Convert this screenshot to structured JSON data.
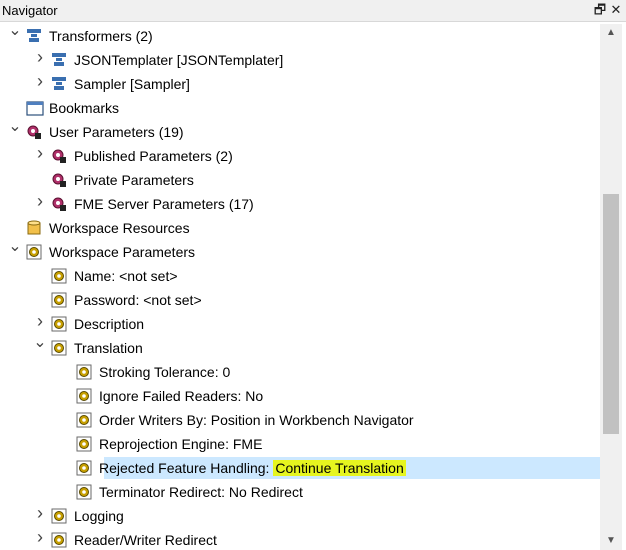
{
  "window": {
    "title": "Navigator",
    "restore_glyph": "🗗",
    "close_glyph": "✕"
  },
  "tree": [
    {
      "id": "transformers",
      "label": "Transformers (2)",
      "icon": "transformer-icon",
      "state": "expanded",
      "level": 0
    },
    {
      "id": "jsontemplater",
      "label": "JSONTemplater [JSONTemplater]",
      "icon": "transformer-icon",
      "state": "collapsed",
      "level": 1
    },
    {
      "id": "sampler",
      "label": "Sampler [Sampler]",
      "icon": "transformer-icon",
      "state": "collapsed",
      "level": 1
    },
    {
      "id": "bookmarks",
      "label": "Bookmarks",
      "icon": "bookmark-icon",
      "state": "none",
      "level": 0
    },
    {
      "id": "user-params",
      "label": "User Parameters (19)",
      "icon": "user-parameters-icon",
      "state": "expanded",
      "level": 0
    },
    {
      "id": "published",
      "label": "Published Parameters (2)",
      "icon": "published-parameters-icon",
      "state": "collapsed",
      "level": 1
    },
    {
      "id": "private",
      "label": "Private Parameters",
      "icon": "private-parameters-icon",
      "state": "none",
      "level": 1
    },
    {
      "id": "fme-server",
      "label": "FME Server Parameters (17)",
      "icon": "server-parameters-icon",
      "state": "collapsed",
      "level": 1
    },
    {
      "id": "ws-resources",
      "label": "Workspace Resources",
      "icon": "database-icon",
      "state": "none",
      "level": 0
    },
    {
      "id": "ws-params",
      "label": "Workspace Parameters",
      "icon": "gear-icon",
      "state": "expanded",
      "level": 0
    },
    {
      "id": "name",
      "label": "Name: <not set>",
      "icon": "gear-icon",
      "state": "none",
      "level": 1
    },
    {
      "id": "password",
      "label": "Password: <not set>",
      "icon": "gear-icon",
      "state": "none",
      "level": 1
    },
    {
      "id": "description",
      "label": "Description",
      "icon": "gear-icon",
      "state": "collapsed",
      "level": 1
    },
    {
      "id": "translation",
      "label": "Translation",
      "icon": "gear-icon",
      "state": "expanded",
      "level": 1
    },
    {
      "id": "stroking",
      "label": "Stroking Tolerance: 0",
      "icon": "gear-icon",
      "state": "none",
      "level": 2
    },
    {
      "id": "ignore-failed",
      "label": "Ignore Failed Readers: No",
      "icon": "gear-icon",
      "state": "none",
      "level": 2
    },
    {
      "id": "order-writers",
      "label": "Order Writers By: Position in Workbench Navigator",
      "icon": "gear-icon",
      "state": "none",
      "level": 2
    },
    {
      "id": "reprojection",
      "label": "Reprojection Engine: FME",
      "icon": "gear-icon",
      "state": "none",
      "level": 2
    },
    {
      "id": "rejected",
      "label": "Rejected Feature Handling:",
      "value_highlight": "Continue Translation",
      "icon": "gear-icon",
      "state": "none",
      "level": 2,
      "selected": true
    },
    {
      "id": "terminator",
      "label": "Terminator Redirect: No Redirect",
      "icon": "gear-icon",
      "state": "none",
      "level": 2
    },
    {
      "id": "logging",
      "label": "Logging",
      "icon": "gear-icon",
      "state": "collapsed",
      "level": 1
    },
    {
      "id": "reader-writer",
      "label": "Reader/Writer Redirect",
      "icon": "gear-icon",
      "state": "collapsed",
      "level": 1
    }
  ],
  "colors": {
    "selection": "#cce8ff",
    "highlight": "#e6f51f",
    "transformer": "#3a6fb0",
    "gear": "#c8a000"
  }
}
